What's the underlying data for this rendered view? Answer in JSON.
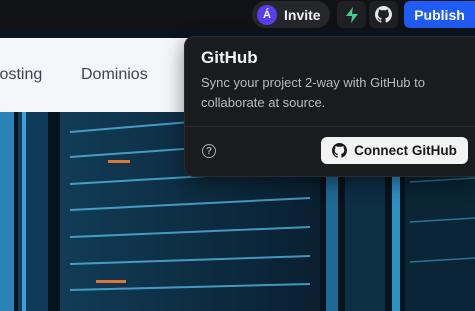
{
  "toolbar": {
    "avatar_initial": "Á",
    "invite_label": "Invite",
    "publish_label": "Publish",
    "colors": {
      "avatar": "#5b3df0",
      "publish": "#1f5bf5",
      "supabase": "#3ecf8e"
    }
  },
  "site": {
    "nav": [
      "Hosting",
      "Dominios"
    ]
  },
  "popover": {
    "title": "GitHub",
    "description": "Sync your project 2-way with GitHub to collaborate at source.",
    "connect_label": "Connect GitHub"
  },
  "icons": [
    "supabase-icon",
    "github-icon",
    "help-icon"
  ]
}
